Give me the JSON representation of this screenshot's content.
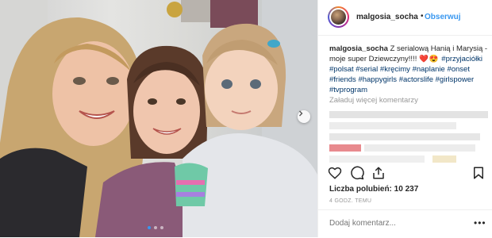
{
  "post": {
    "username": "malgosia_socha",
    "separator": "•",
    "follow_label": "Obserwuj",
    "caption_text": "Z serialową Hanią i Marysią - moje super Dziewczyny!!!!",
    "caption_emoji": "❤️😍",
    "hashtags": [
      "#przyjaciółki",
      "#polsat",
      "#serial",
      "#kręcimy",
      "#naplanie",
      "#onset",
      "#friends",
      "#happygirls",
      "#actorslife",
      "#girlspower",
      "#tvprogram"
    ],
    "load_more": "Załaduj więcej komentarzy",
    "likes_text": "Liczba polubień: 10 237",
    "timestamp": "4 GODZ. TEMU",
    "comment_placeholder": "Dodaj komentarz...",
    "more_label": "•••"
  },
  "carousel": {
    "slides": 3,
    "active_index": 0
  },
  "icons": {
    "like": "heart-icon",
    "comment": "comment-icon",
    "share": "share-icon",
    "save": "bookmark-icon",
    "next": "chevron-right-icon"
  },
  "colors": {
    "accent": "#3897f0",
    "heart": "#ed4956",
    "hashtag": "#003569",
    "muted": "#999999"
  }
}
